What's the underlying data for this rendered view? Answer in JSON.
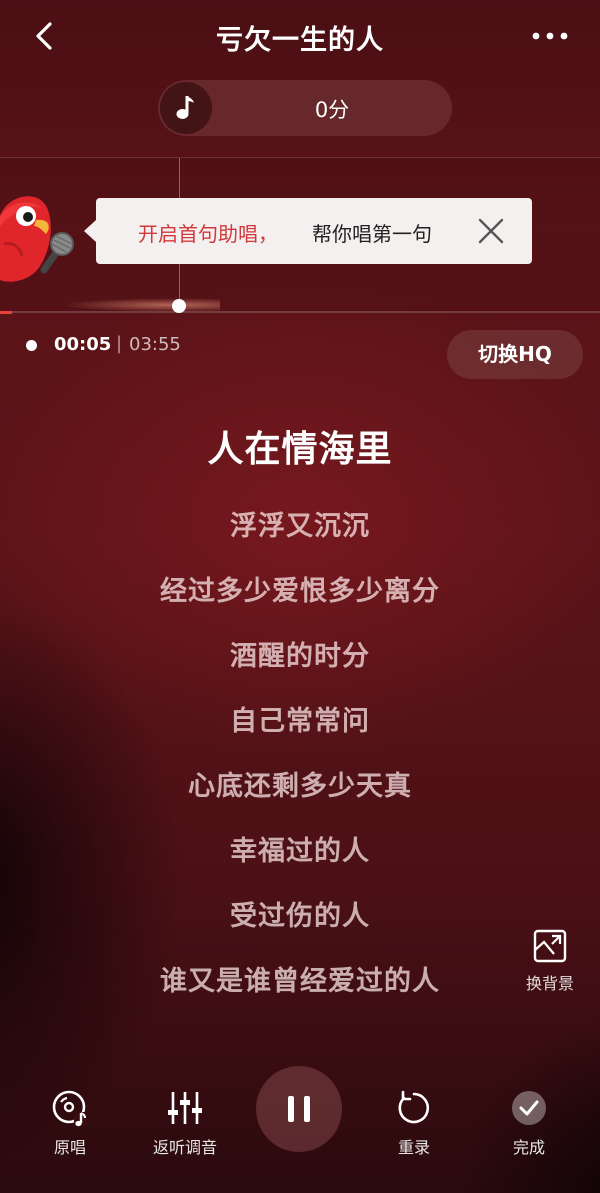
{
  "header": {
    "back_icon": "chevron-left-icon",
    "title": "亏欠一生的人",
    "more_icon": "more-horizontal-icon"
  },
  "score": {
    "icon": "music-note-icon",
    "text": "0分"
  },
  "assist_tip": {
    "highlight": "开启首句助唱，",
    "text": "帮你唱第一句",
    "close_icon": "close-icon"
  },
  "playback": {
    "current_time": "00:05",
    "separator": "|",
    "total_time": "03:55",
    "progress_fraction": 0.02
  },
  "quality_button": "切换HQ",
  "lyrics": {
    "current": "人在情海里",
    "upcoming": [
      "浮浮又沉沉",
      "经过多少爱恨多少离分",
      "酒醒的时分",
      "自己常常问",
      "心底还剩多少天真",
      "幸福过的人",
      "受过伤的人",
      "谁又是谁曾经爱过的人"
    ]
  },
  "change_background": {
    "icon": "image-swap-icon",
    "label": "换背景"
  },
  "controls": {
    "original": {
      "icon": "original-vocal-icon",
      "label": "原唱"
    },
    "tuning": {
      "icon": "equalizer-sliders-icon",
      "label": "返听调音"
    },
    "pause": {
      "icon": "pause-icon"
    },
    "rerecord": {
      "icon": "restart-icon",
      "label": "重录"
    },
    "finish": {
      "icon": "check-circle-icon",
      "label": "完成"
    }
  },
  "colors": {
    "accent_red": "#e8403a",
    "tip_highlight": "#d1383a",
    "background": "#5a1318"
  }
}
